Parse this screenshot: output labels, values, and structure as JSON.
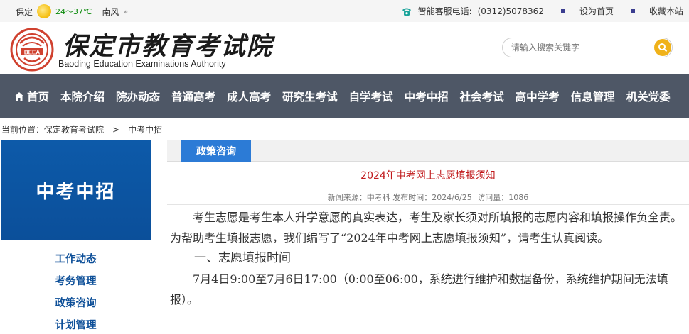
{
  "topbar": {
    "city": "保定",
    "temperature": "24～37℃",
    "wind": "南风",
    "wind_more": "»",
    "hotline_label": "智能客服电话:",
    "hotline_number": "(0312)5078362",
    "set_home": "设为首页",
    "bookmark": "收藏本站"
  },
  "header": {
    "logo_cn": "保定市教育考试院",
    "logo_en": "Baoding Education Examinations Authority",
    "seal_text": "BEEA",
    "search_placeholder": "请输入搜索关键字"
  },
  "nav": {
    "items": [
      "首页",
      "本院介绍",
      "院办动态",
      "普通高考",
      "成人高考",
      "研究生考试",
      "自学考试",
      "中考中招",
      "社会考试",
      "高中学考",
      "信息管理",
      "机关党委"
    ]
  },
  "breadcrumb": {
    "label": "当前位置：",
    "home": "保定教育考试院",
    "separator": ">",
    "current": "中考中招"
  },
  "sidebar": {
    "banner_title": "中考中招",
    "items": [
      "工作动态",
      "考务管理",
      "政策咨询",
      "计划管理"
    ]
  },
  "article": {
    "tab": "政策咨询",
    "title": "2024年中考网上志愿填报须知",
    "source_label": "新闻来源：",
    "source": "中考科",
    "time_label": "发布时间：",
    "time": "2024/6/25",
    "views_label": "访问量：",
    "views": "1086",
    "para1": "考生志愿是考生本人升学意愿的真实表达，考生及家长须对所填报的志愿内容和填报操作负全责。为帮助考生填报志愿，我们编写了“2024年中考网上志愿填报须知”，请考生认真阅读。",
    "heading1": "一、志愿填报时间",
    "para2": "7月4日9:00至7月6日17:00（0:00至06:00，系统进行维护和数据备份，系统维护期间无法填报）。"
  },
  "colors": {
    "nav_bg": "#4e5766",
    "banner_blue": "#0d5aa9",
    "tab_blue": "#2c7bd6",
    "title_red": "#c0191b",
    "search_btn": "#f0b21a"
  }
}
